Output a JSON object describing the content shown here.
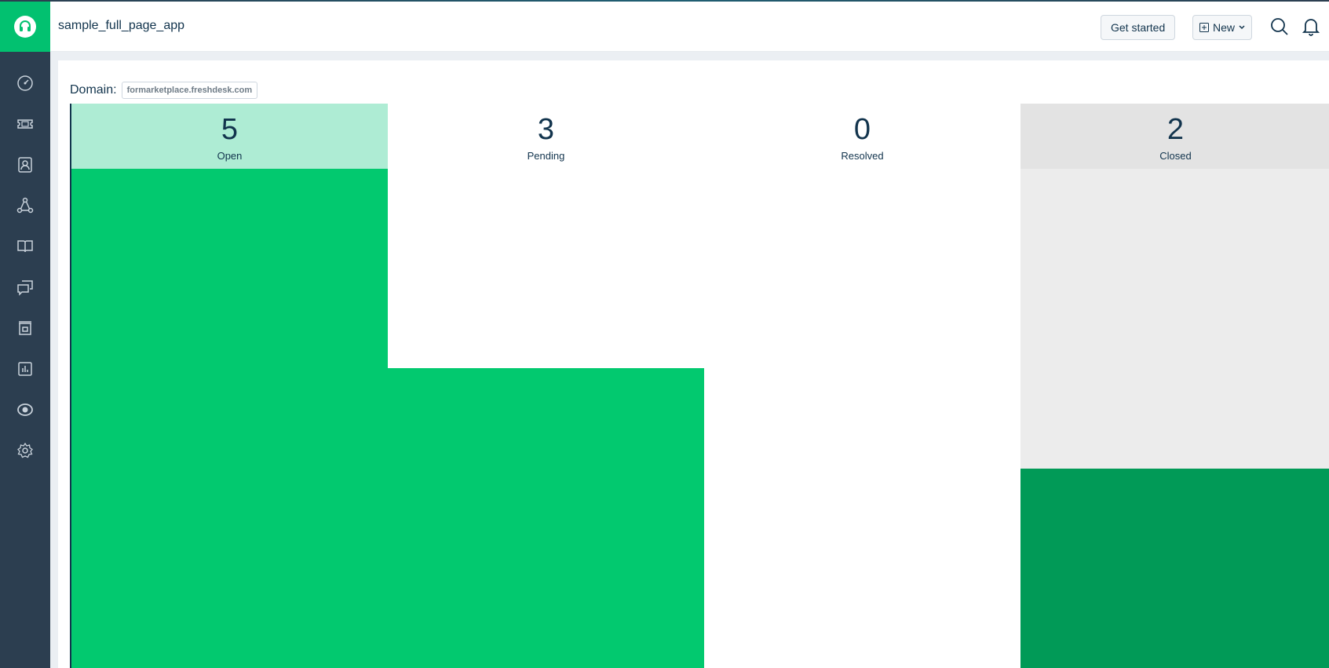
{
  "app": {
    "title": "sample_full_page_app",
    "logo_icon": "headset-icon",
    "brand_color": "#02c170"
  },
  "header": {
    "get_started_label": "Get started",
    "new_label": "New",
    "new_icon": "plus-square-icon",
    "search_icon": "search-icon",
    "notification_icon": "bell-icon"
  },
  "sidebar": {
    "items": [
      {
        "name": "dashboard",
        "icon": "gauge-icon"
      },
      {
        "name": "tickets",
        "icon": "ticket-icon"
      },
      {
        "name": "contacts",
        "icon": "contact-icon"
      },
      {
        "name": "groups",
        "icon": "network-icon"
      },
      {
        "name": "solutions",
        "icon": "book-icon"
      },
      {
        "name": "forums",
        "icon": "chat-icon"
      },
      {
        "name": "social",
        "icon": "store-icon"
      },
      {
        "name": "reports",
        "icon": "bar-chart-icon"
      },
      {
        "name": "apps",
        "icon": "eye-icon"
      },
      {
        "name": "admin",
        "icon": "gear-icon"
      }
    ]
  },
  "main": {
    "domain_label": "Domain:",
    "domain_value": "formarketplace.freshdesk.com"
  },
  "colors": {
    "bar": "#02c96f",
    "bar_dark": "#019a57",
    "open_header": "#aeecd4",
    "closed_header": "#e3e3e3",
    "closed_body": "#ececec"
  },
  "chart_data": {
    "type": "bar",
    "categories": [
      "Open",
      "Pending",
      "Resolved",
      "Closed"
    ],
    "values": [
      5,
      3,
      0,
      2
    ]
  }
}
